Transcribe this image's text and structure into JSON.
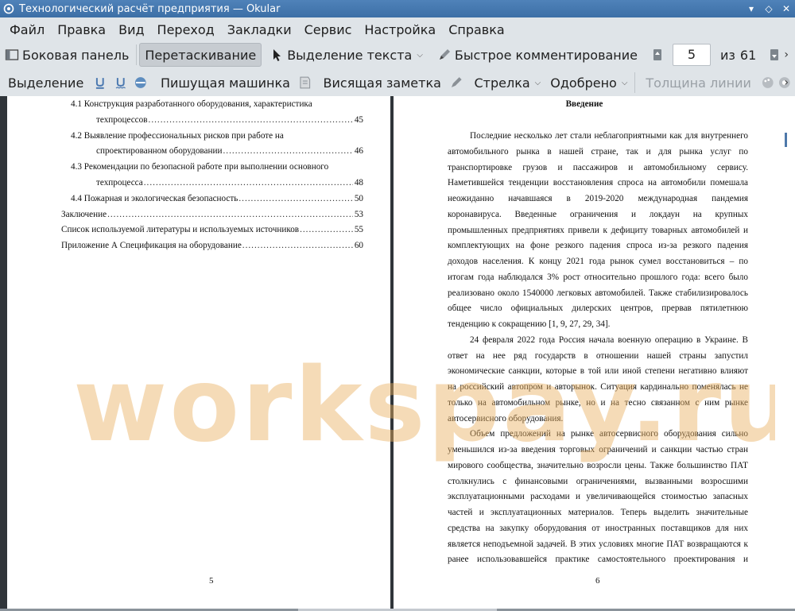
{
  "window": {
    "title": "Технологический расчёт предприятия  — Okular"
  },
  "menu": [
    "Файл",
    "Правка",
    "Вид",
    "Переход",
    "Закладки",
    "Сервис",
    "Настройка",
    "Справка"
  ],
  "toolbar1": {
    "sidebar": "Боковая панель",
    "browse": "Перетаскивание",
    "text_select": "Выделение текста",
    "quick_comment": "Быстрое комментирование",
    "current_page": "5",
    "of_label": "из",
    "total_pages": "61"
  },
  "toolbar2": {
    "highlight": "Выделение",
    "typewriter": "Пишущая машинка",
    "popup_note": "Висящая заметка",
    "arrow": "Стрелка",
    "stamp": "Одобрено",
    "line_width": "Толщина линии"
  },
  "left_page": {
    "toc": [
      {
        "text": "4.1 Конструкция разработанного оборудования, характеристика",
        "page": ""
      },
      {
        "text": "техпроцессов",
        "page": "45"
      },
      {
        "text": "4.2 Выявление профессиональных рисков при работе на",
        "page": ""
      },
      {
        "text": "спроектированном оборудовании",
        "page": "46"
      },
      {
        "text": "4.3 Рекомендации по безопасной работе при выполнении основного",
        "page": ""
      },
      {
        "text": "техпроцесса",
        "page": "48"
      },
      {
        "text": "4.4 Пожарная и экологическая безопасность",
        "page": "50"
      },
      {
        "text": "Заключение",
        "page": "53"
      },
      {
        "text": "Список используемой литературы и используемых источников",
        "page": "55"
      },
      {
        "text": "Приложение А Спецификация на оборудование",
        "page": "60"
      }
    ],
    "page_number": "5"
  },
  "right_page": {
    "heading": "Введение",
    "lines": [
      "Последние несколько лет стали неблагоприятными как для внутреннего",
      "автомобильного рынка в нашей стране, так и для рынка услуг по",
      "транспортировке грузов и пассажиров и автомобильному сервису.",
      "Наметившейся тенденции восстановления спроса на автомобили помешала",
      "неожиданно начавшаяся в 2019-2020 международная пандемия",
      "коронавируса. Введенные ограничения и локдаун на крупных",
      "промышленных предприятиях привели к дефициту товарных автомобилей и",
      "комплектующих на фоне резкого падения спроса из-за резкого падения",
      "доходов населения. К концу 2021 года рынок сумел восстановиться – по",
      "итогам года наблюдался 3% рост относительно прошлого года: всего было",
      "реализовано около 1540000 легковых автомобилей. Также стабилизировалось",
      "общее число официальных дилерских центров, прервав пятилетнюю",
      "тенденцию к сокращению [1, 9, 27, 29, 34].",
      "24 февраля 2022 года Россия начала военную операцию в Украине. В",
      "ответ на нее ряд государств в отношении нашей страны запустил",
      "экономические санкции, которые в той или иной степени негативно влияют",
      "на российский автопром и авторынок. Ситуация кардинально поменялась не",
      "только на автомобильном рынке, но и на тесно связанном с ним рынке",
      "автосервисного оборудования.",
      "Объем предложений на рынке автосервисного оборудования сильно",
      "уменьшился из-за введения торговых ограничений и санкции частью стран",
      "мирового сообщества, значительно возросли цены. Также большинство ПАТ",
      "столкнулись с финансовыми ограничениями, вызванными возросшими",
      "эксплуатационными расходами и увеличивающейся стоимостью запасных",
      "частей и эксплуатационных материалов. Теперь выделить значительные",
      "средства на закупку оборудования от иностранных поставщиков для них",
      "является неподъемной задачей. В этих условиях многие ПАТ возвращаются к",
      "ранее использовавшейся практике самостоятельного проектирования и"
    ],
    "page_number": "6"
  },
  "watermark": "workspay.ru"
}
